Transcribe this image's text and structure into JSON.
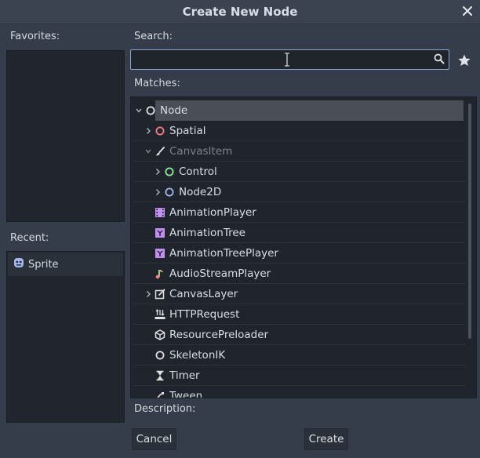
{
  "dialog": {
    "title": "Create New Node"
  },
  "favorites": {
    "label": "Favorites:"
  },
  "recent": {
    "label": "Recent:",
    "items": [
      {
        "label": "Sprite",
        "icon": "sprite-icon"
      }
    ]
  },
  "search": {
    "label": "Search:",
    "value": "",
    "placeholder": ""
  },
  "matches": {
    "label": "Matches:",
    "rows": [
      {
        "label": "Node",
        "icon": "node-circle-icon",
        "expanded": true,
        "selected": true
      },
      {
        "label": "Spatial",
        "icon": "spatial-circle-icon",
        "expanded": false
      },
      {
        "label": "CanvasItem",
        "icon": "brush-icon",
        "expanded": true,
        "disabled": true
      },
      {
        "label": "Control",
        "icon": "control-circle-icon",
        "expanded": false
      },
      {
        "label": "Node2D",
        "icon": "node2d-circle-icon",
        "expanded": false
      },
      {
        "label": "AnimationPlayer",
        "icon": "animation-player-icon"
      },
      {
        "label": "AnimationTree",
        "icon": "animation-tree-icon"
      },
      {
        "label": "AnimationTreePlayer",
        "icon": "animation-tree-player-icon"
      },
      {
        "label": "AudioStreamPlayer",
        "icon": "audio-note-icon"
      },
      {
        "label": "CanvasLayer",
        "icon": "canvas-layer-icon",
        "expanded": false
      },
      {
        "label": "HTTPRequest",
        "icon": "http-request-icon"
      },
      {
        "label": "ResourcePreloader",
        "icon": "cube-icon"
      },
      {
        "label": "SkeletonIK",
        "icon": "skeleton-ik-circle-icon"
      },
      {
        "label": "Timer",
        "icon": "hourglass-icon"
      },
      {
        "label": "Tween",
        "icon": "tween-icon"
      }
    ]
  },
  "description": {
    "label": "Description:"
  },
  "buttons": {
    "cancel": "Cancel",
    "create": "Create"
  },
  "colors": {
    "background": "#363d4a",
    "panel": "#21262e",
    "accent_blue": "#8da5d4",
    "spatial": "#fc7f7f",
    "control": "#8eef97",
    "node2d": "#a5b7f3",
    "animation_purple": "#c38ef1"
  }
}
